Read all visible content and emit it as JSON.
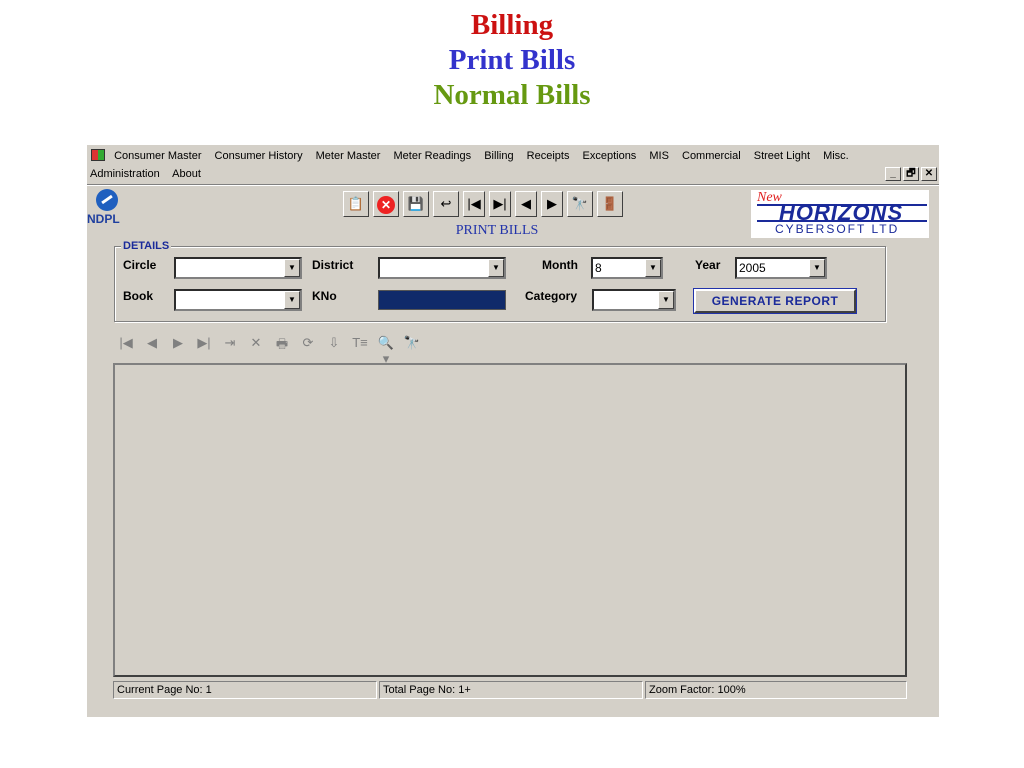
{
  "slide": {
    "title_line_1": "Billing",
    "title_line_2": "Print Bills",
    "title_line_3": "Normal Bills"
  },
  "menubar": {
    "row1": [
      "Consumer Master",
      "Consumer History",
      "Meter Master",
      "Meter Readings",
      "Billing",
      "Receipts",
      "Exceptions",
      "MIS",
      "Commercial",
      "Street Light",
      "Misc."
    ],
    "row2": [
      "Administration",
      "About"
    ]
  },
  "window_controls": {
    "minimize": "_",
    "restore": "🗗",
    "close": "✕"
  },
  "logos": {
    "ndpl": "NDPL",
    "horizons_new": "New",
    "horizons_main": "HORIZONS",
    "horizons_sub": "CYBERSOFT LTD"
  },
  "toolbar": {
    "buttons": [
      "report-icon",
      "close-icon",
      "save-icon",
      "undo-icon",
      "first-icon",
      "last-icon",
      "prev-icon",
      "next-icon",
      "find-icon",
      "exit-icon"
    ],
    "glyphs": [
      "📋",
      "✕",
      "💾",
      "↩",
      "|◀",
      "▶|",
      "◀",
      "▶",
      "🔭",
      "🚪"
    ]
  },
  "form": {
    "heading": "PRINT BILLS",
    "legend": "DETAILS",
    "circle_label": "Circle",
    "circle_value": "",
    "district_label": "District",
    "district_value": "",
    "month_label": "Month",
    "month_value": "8",
    "year_label": "Year",
    "year_value": "2005",
    "book_label": "Book",
    "book_value": "",
    "kno_label": "KNo",
    "category_label": "Category",
    "category_value": "",
    "generate_label": "GENERATE REPORT"
  },
  "viewer_toolbar": {
    "glyphs": [
      "|◀",
      "◀",
      "▶",
      "▶|",
      "⇥",
      "✕",
      "🖶",
      "⟳",
      "⇩",
      "T≡",
      "🔍▾",
      "🔭"
    ]
  },
  "statusbar": {
    "current_page": "Current Page No: 1",
    "total_page": "Total Page No: 1+",
    "zoom": "Zoom Factor: 100%"
  },
  "colors": {
    "title1": "#cc1111",
    "title2": "#3333cc",
    "title3": "#669911",
    "window_bg": "#d4d0c8",
    "accent": "#1a2a9a",
    "kno_field": "#102a6a"
  }
}
